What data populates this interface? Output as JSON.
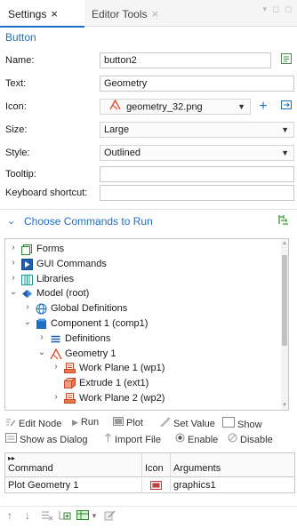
{
  "tabs": {
    "active_label": "Settings",
    "inactive_label": "Editor Tools",
    "close_glyph": "×",
    "window_controls": "▾ ◻ ◻"
  },
  "section_title": "Button",
  "form": {
    "name_label": "Name:",
    "name_value": "button2",
    "text_label": "Text:",
    "text_value": "Geometry",
    "icon_label": "Icon:",
    "icon_value": "geometry_32.png",
    "size_label": "Size:",
    "size_value": "Large",
    "style_label": "Style:",
    "style_value": "Outlined",
    "tooltip_label": "Tooltip:",
    "tooltip_value": "",
    "shortcut_label": "Keyboard shortcut:",
    "shortcut_value": ""
  },
  "commands_section": {
    "chevron": "⌄",
    "title": "Choose Commands to Run"
  },
  "tree": [
    {
      "label": "Forms",
      "icon": "forms-icon",
      "indent": 0,
      "arrow": "›"
    },
    {
      "label": "GUI Commands",
      "icon": "gui-commands-icon",
      "indent": 0,
      "arrow": "›"
    },
    {
      "label": "Libraries",
      "icon": "libraries-icon",
      "indent": 0,
      "arrow": "›"
    },
    {
      "label": "Model (root)",
      "icon": "model-icon",
      "indent": 0,
      "arrow": "⌄"
    },
    {
      "label": "Global Definitions",
      "icon": "globe-icon",
      "indent": 1,
      "arrow": "›"
    },
    {
      "label": "Component 1 (comp1)",
      "icon": "component-icon",
      "indent": 1,
      "arrow": "⌄"
    },
    {
      "label": "Definitions",
      "icon": "definitions-icon",
      "indent": 2,
      "arrow": "›"
    },
    {
      "label": "Geometry 1",
      "icon": "geometry-icon",
      "indent": 2,
      "arrow": "⌄"
    },
    {
      "label": "Work Plane 1 (wp1)",
      "icon": "workplane-icon",
      "indent": 3,
      "arrow": "›"
    },
    {
      "label": "Extrude 1 (ext1)",
      "icon": "extrude-icon",
      "indent": 3,
      "arrow": ""
    },
    {
      "label": "Work Plane 2 (wp2)",
      "icon": "workplane-icon",
      "indent": 3,
      "arrow": "›"
    }
  ],
  "actions_row1": {
    "edit_node": "Edit Node",
    "run": "Run",
    "plot": "Plot",
    "set_value": "Set Value",
    "show": "Show"
  },
  "actions_row2": {
    "show_as_dialog": "Show as Dialog",
    "import_file": "Import File",
    "enable": "Enable",
    "disable": "Disable"
  },
  "table": {
    "headers": [
      "Command",
      "Icon",
      "Arguments"
    ],
    "rows": [
      {
        "command": "Plot Geometry 1",
        "icon": "plot-icon",
        "arguments": "graphics1"
      }
    ]
  },
  "colors": {
    "accent": "#1c6fc6",
    "geometry_red": "#e0502a"
  }
}
